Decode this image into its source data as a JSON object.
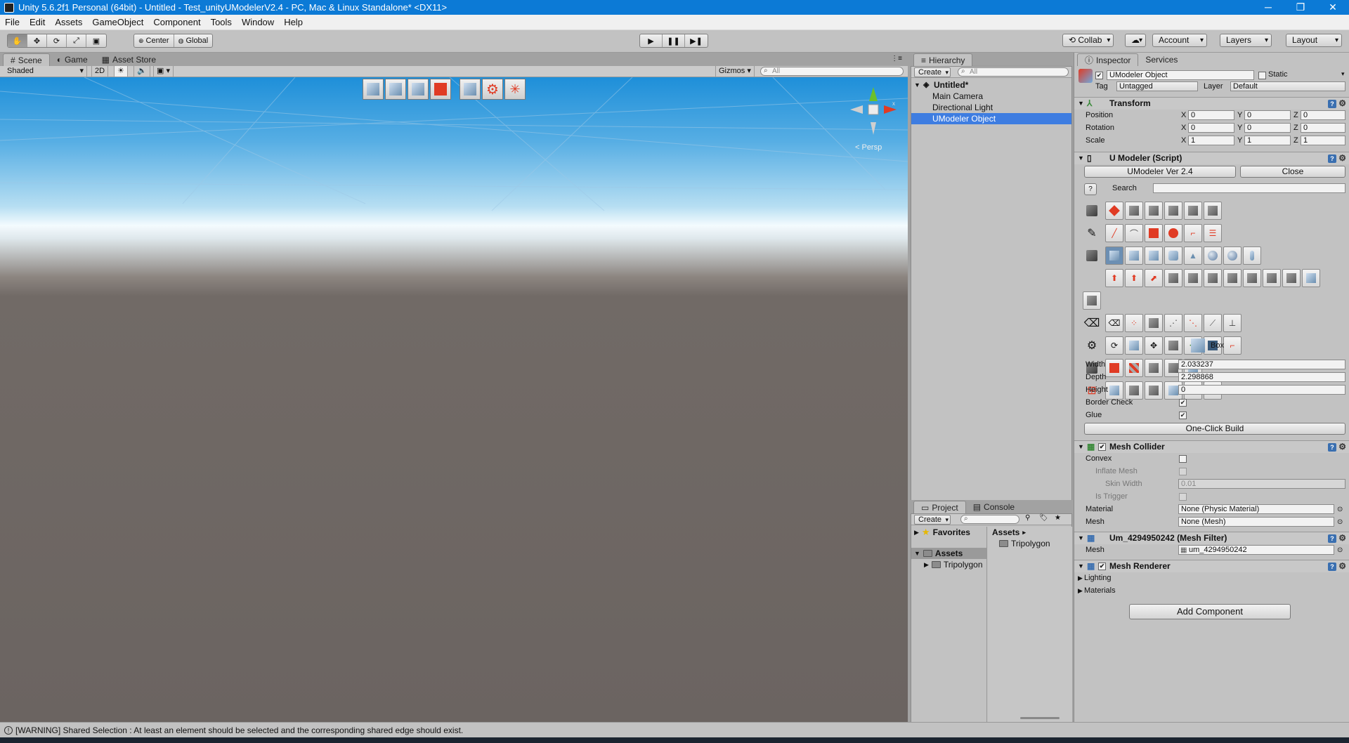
{
  "window": {
    "title": "Unity 5.6.2f1 Personal (64bit) - Untitled - Test_unityUModelerV2.4 - PC, Mac & Linux Standalone* <DX11>",
    "controls": [
      "─",
      "❐",
      "✕"
    ]
  },
  "menu": [
    "File",
    "Edit",
    "Assets",
    "GameObject",
    "Component",
    "Tools",
    "Window",
    "Help"
  ],
  "toolbar": {
    "transform_tools": [
      "hand-icon",
      "move-icon",
      "rotate-icon",
      "scale-icon",
      "rect-icon"
    ],
    "pivot": "Center",
    "space": "Global",
    "play_icons": [
      "play-icon",
      "pause-icon",
      "step-icon"
    ],
    "collab": "Collab",
    "account": "Account",
    "layers": "Layers",
    "layout": "Layout"
  },
  "scene_tabs": [
    {
      "label": "Scene",
      "icon": "#"
    },
    {
      "label": "Game",
      "icon": "◐"
    },
    {
      "label": "Asset Store",
      "icon": "▦"
    }
  ],
  "scene_bar": {
    "shading": "Shaded",
    "mode_2d": "2D",
    "gizmos": "Gizmos",
    "search_placeholder": "All"
  },
  "scene_view": {
    "persp_label": "< Persp"
  },
  "hierarchy": {
    "tab": "Hierarchy",
    "create": "Create",
    "search_placeholder": "All",
    "scene_name": "Untitled*",
    "items": [
      "Main Camera",
      "Directional Light",
      "UModeler Object"
    ],
    "selected_index": 2
  },
  "project": {
    "tabs": [
      "Project",
      "Console"
    ],
    "create": "Create",
    "favorites": "Favorites",
    "assets": "Assets",
    "tree_child": "Tripolygon",
    "breadcrumb": "Assets",
    "files": [
      "Tripolygon"
    ]
  },
  "inspector": {
    "tabs": [
      "Inspector",
      "Services"
    ],
    "object_name": "UModeler Object",
    "static_label": "Static",
    "tag_label": "Tag",
    "tag_value": "Untagged",
    "layer_label": "Layer",
    "layer_value": "Default",
    "transform": {
      "title": "Transform",
      "rows": [
        {
          "label": "Position",
          "x": "0",
          "y": "0",
          "z": "0"
        },
        {
          "label": "Rotation",
          "x": "0",
          "y": "0",
          "z": "0"
        },
        {
          "label": "Scale",
          "x": "1",
          "y": "1",
          "z": "1"
        }
      ]
    },
    "umodeler": {
      "title": "U Modeler (Script)",
      "version_button": "UModeler Ver 2.4",
      "close_button": "Close",
      "help": "?",
      "search_label": "Search",
      "selected_tool": "Box",
      "fields": [
        {
          "label": "Width",
          "value": "2.033237"
        },
        {
          "label": "Depth",
          "value": "2.298868"
        },
        {
          "label": "Height",
          "value": "0"
        }
      ],
      "border_check": "Border Check",
      "glue": "Glue",
      "build_button": "One-Click Build"
    },
    "mesh_collider": {
      "title": "Mesh Collider",
      "convex": "Convex",
      "inflate_mesh": "Inflate Mesh",
      "skin_width": "Skin Width",
      "skin_width_value": "0.01",
      "is_trigger": "Is Trigger",
      "material_label": "Material",
      "material_value": "None (Physic Material)",
      "mesh_label": "Mesh",
      "mesh_value": "None (Mesh)"
    },
    "mesh_filter": {
      "title": "Um_4294950242 (Mesh Filter)",
      "mesh_label": "Mesh",
      "mesh_value": "um_4294950242"
    },
    "mesh_renderer": {
      "title": "Mesh Renderer",
      "lighting": "Lighting",
      "materials": "Materials"
    },
    "add_component": "Add Component"
  },
  "status": {
    "message": "[WARNING] Shared Selection : At least an element should be selected and the corresponding shared edge should exist."
  },
  "colors": {
    "titlebar": "#0c7ad6",
    "selection": "#3e7de1",
    "panel": "#c2c2c2",
    "accent_red": "#e03b24"
  }
}
